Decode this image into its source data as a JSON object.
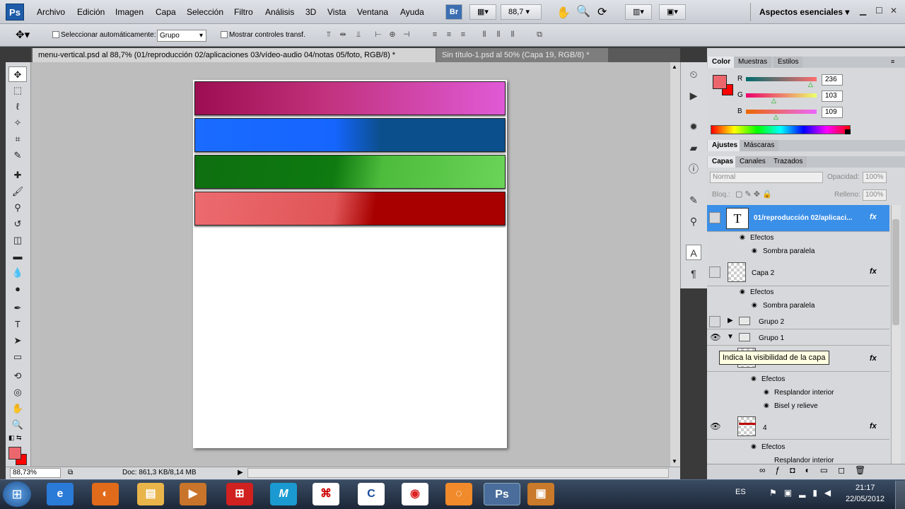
{
  "app": {
    "logo": "Ps"
  },
  "menu": [
    "Archivo",
    "Edición",
    "Imagen",
    "Capa",
    "Selección",
    "Filtro",
    "Análisis",
    "3D",
    "Vista",
    "Ventana",
    "Ayuda"
  ],
  "menubar": {
    "bridge_label": "Br",
    "zoom": "88,7",
    "workspace": "Aspectos esenciales"
  },
  "options": {
    "auto_select_label": "Seleccionar automáticamente:",
    "auto_select_value": "Grupo",
    "show_transform_label": "Mostrar controles transf."
  },
  "tabs": [
    {
      "label": "menu-vertical.psd al 88,7% (01/reproducción 02/aplicaciones 03/vídeo-audio 04/notas 05/foto, RGB/8) *"
    },
    {
      "label": "Sin título-1.psd al 50% (Capa 19, RGB/8) *"
    }
  ],
  "canvas": {
    "bars": [
      {
        "color_from": "#9c0d52",
        "color_to": "#e05ad6"
      },
      {
        "color_from": "#1a6bff",
        "color_to": "#0b4f8c"
      },
      {
        "color_from": "#0e6f10",
        "color_to": "#6ad458"
      },
      {
        "color_from": "#ec6b6f",
        "color_to": "#a80000"
      }
    ]
  },
  "status": {
    "zoom": "88,73%",
    "doc": "Doc: 861,3 KB/8,14 MB"
  },
  "color_panel": {
    "tabs": [
      "Color",
      "Muestras",
      "Estilos"
    ],
    "fg_color": "#ec676d",
    "bg_color": "#ff0000",
    "r_label": "R",
    "r": "236",
    "g_label": "G",
    "g": "103",
    "b_label": "B",
    "b": "109"
  },
  "adjust_panel": {
    "tabs": [
      "Ajustes",
      "Máscaras"
    ]
  },
  "layers_panel": {
    "tabs": [
      "Capas",
      "Canales",
      "Trazados"
    ],
    "blend_mode": "Normal",
    "opacity_label": "Opacidad:",
    "opacity": "100%",
    "lock_label": "Bloq.:",
    "fill_label": "Relleno:",
    "fill": "100%",
    "layers": [
      {
        "name": "01/reproducción 02/aplicaci...",
        "effects_label": "Efectos",
        "effects": [
          "Sombra paralela"
        ]
      },
      {
        "name": "Capa 2",
        "effects_label": "Efectos",
        "effects": [
          "Sombra paralela"
        ]
      },
      {
        "name": "Grupo 2"
      },
      {
        "name": "Grupo 1"
      },
      {
        "name": "",
        "effects_label": "Efectos",
        "effects": [
          "Resplandor interior",
          "Bisel y relieve"
        ]
      },
      {
        "name": "4",
        "effects_label": "Efectos",
        "effects": [
          "Resplandor interior"
        ]
      }
    ],
    "fx_label": "fx"
  },
  "tooltip": "Indica la visibilidad de la capa",
  "taskbar": {
    "lang": "ES",
    "time": "21:17",
    "date": "22/05/2012"
  }
}
